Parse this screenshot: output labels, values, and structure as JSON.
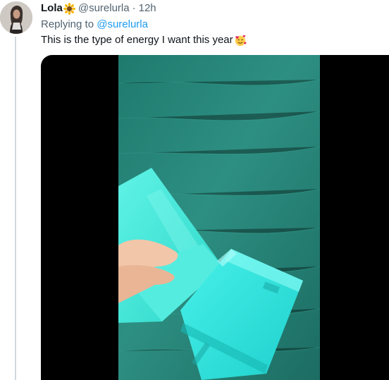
{
  "tweet": {
    "display_name": "Lola",
    "name_emoji_icon": "sunflower-emoji-icon",
    "handle": "@surelurla",
    "separator": "·",
    "time": "12h",
    "reply_prefix": "Replying to",
    "reply_to": "@surelurla",
    "text": "This is the type of energy I want this year",
    "text_emoji_icon": "smiling-face-with-hearts-emoji-icon"
  },
  "media": {
    "type": "video",
    "description_icon": "video-thumbnail"
  },
  "colors": {
    "primary_text": "#0f1419",
    "secondary_text": "#536471",
    "link": "#1d9bf0",
    "thread_line": "#cfd9de"
  }
}
